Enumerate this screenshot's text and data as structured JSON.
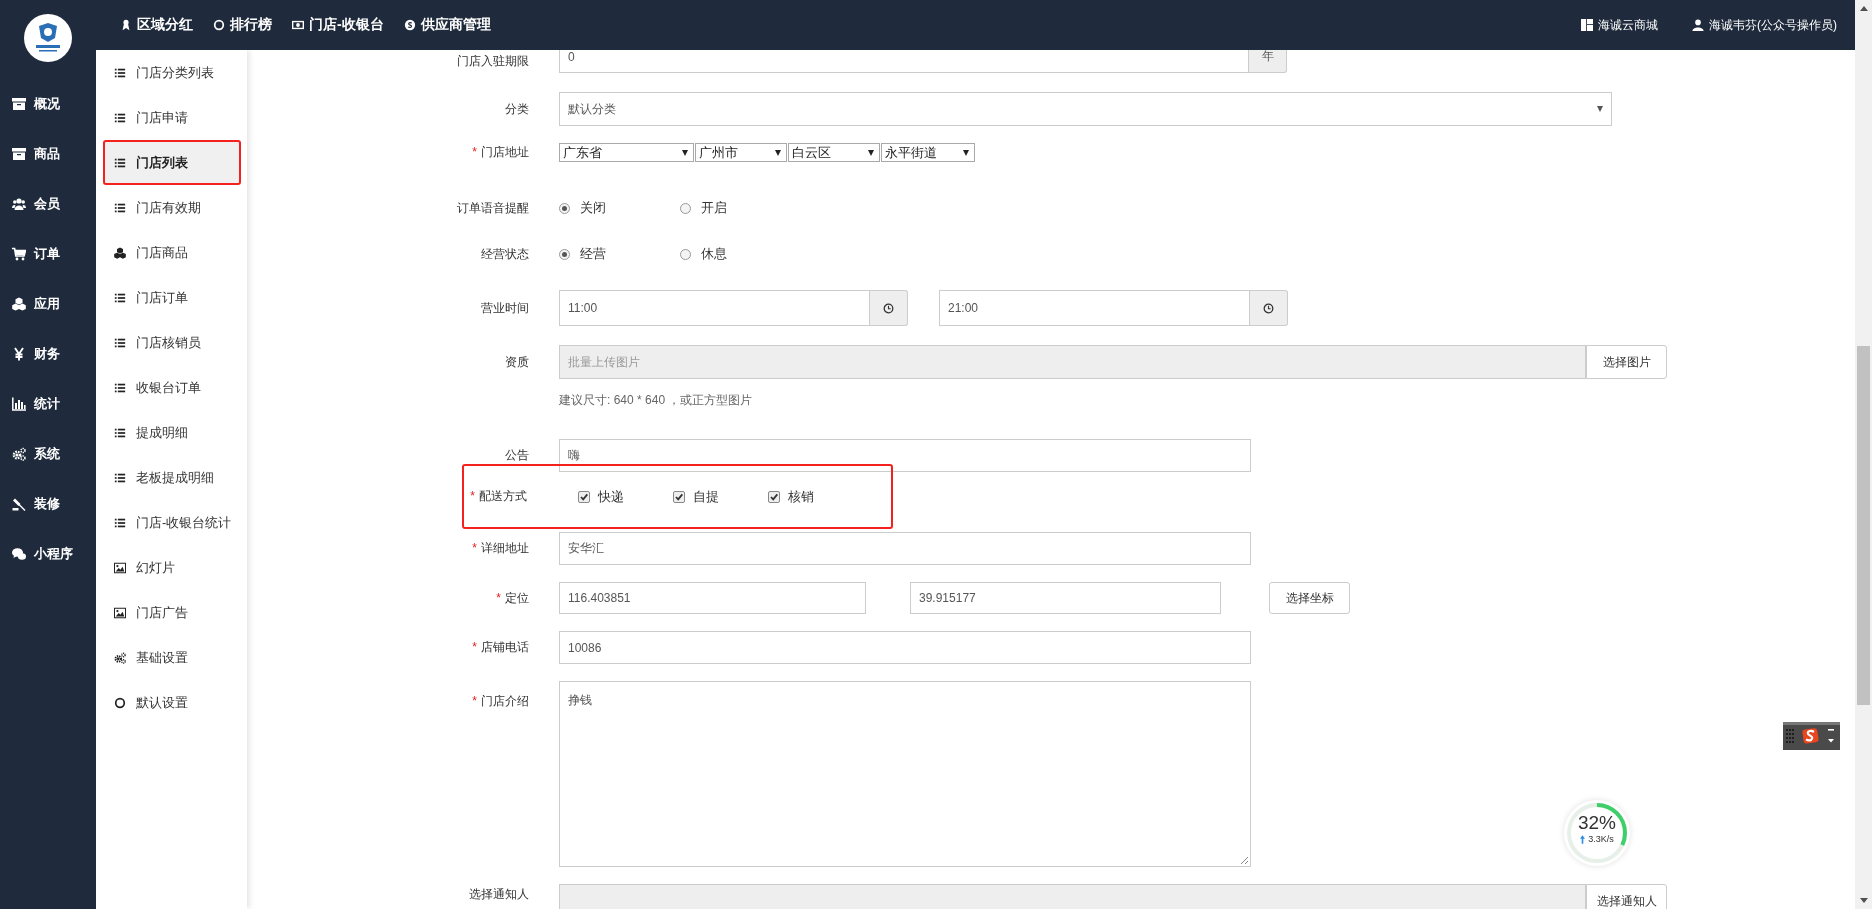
{
  "header": {
    "nav": [
      {
        "label": "区域分红"
      },
      {
        "label": "排行榜"
      },
      {
        "label": "门店-收银台"
      },
      {
        "label": "供应商管理"
      }
    ],
    "right": [
      {
        "label": "海诚云商城"
      },
      {
        "label": "海诚韦芬(公众号操作员)"
      }
    ]
  },
  "sidebar": {
    "items": [
      {
        "label": "概况"
      },
      {
        "label": "商品"
      },
      {
        "label": "会员"
      },
      {
        "label": "订单"
      },
      {
        "label": "应用"
      },
      {
        "label": "财务"
      },
      {
        "label": "统计"
      },
      {
        "label": "系统"
      },
      {
        "label": "装修"
      },
      {
        "label": "小程序"
      }
    ]
  },
  "subnav": {
    "items": [
      {
        "label": "门店分类列表",
        "selected": false,
        "outlined": false
      },
      {
        "label": "门店申请",
        "selected": false,
        "outlined": false
      },
      {
        "label": "门店列表",
        "selected": true,
        "outlined": true
      },
      {
        "label": "门店有效期",
        "selected": false,
        "outlined": false
      },
      {
        "label": "门店商品",
        "selected": false,
        "outlined": false
      },
      {
        "label": "门店订单",
        "selected": false,
        "outlined": false
      },
      {
        "label": "门店核销员",
        "selected": false,
        "outlined": false
      },
      {
        "label": "收银台订单",
        "selected": false,
        "outlined": false
      },
      {
        "label": "提成明细",
        "selected": false,
        "outlined": false
      },
      {
        "label": "老板提成明细",
        "selected": false,
        "outlined": false
      },
      {
        "label": "门店-收银台统计",
        "selected": false,
        "outlined": false
      },
      {
        "label": "幻灯片",
        "selected": false,
        "outlined": false
      },
      {
        "label": "门店广告",
        "selected": false,
        "outlined": false
      },
      {
        "label": "基础设置",
        "selected": false,
        "outlined": false
      },
      {
        "label": "默认设置",
        "selected": false,
        "outlined": false
      }
    ]
  },
  "form": {
    "rows": [
      {
        "kind": "addon",
        "label": "门店入驻期限",
        "value": "0",
        "addon": "年"
      },
      {
        "kind": "select",
        "label": "分类",
        "value": "默认分类"
      },
      {
        "kind": "region",
        "label": "门店地址",
        "mark": "*",
        "selects": [
          "广东省",
          "广州市",
          "白云区",
          "永平街道"
        ]
      },
      {
        "kind": "radio",
        "label": "订单语音提醒",
        "options": [
          {
            "label": "关闭",
            "selected": true
          },
          {
            "label": "开启",
            "selected": false
          }
        ]
      },
      {
        "kind": "radio",
        "label": "经营状态",
        "options": [
          {
            "label": "经营",
            "selected": true
          },
          {
            "label": "休息",
            "selected": false
          }
        ]
      },
      {
        "kind": "time",
        "label": "营业时间",
        "values": [
          "11:00",
          "21:00"
        ]
      },
      {
        "kind": "upload",
        "label": "资质",
        "placeholder": "批量上传图片",
        "button": "选择图片"
      },
      {
        "kind": "hint",
        "text": "建议尺寸: 640 * 640 ，或正方型图片"
      },
      {
        "kind": "text",
        "label": "公告",
        "value": "嗨"
      },
      {
        "kind": "checks",
        "label": "配送方式",
        "mark": "*",
        "outlined": true,
        "options": [
          {
            "label": "快递",
            "checked": true
          },
          {
            "label": "自提",
            "checked": true
          },
          {
            "label": "核销",
            "checked": true
          }
        ]
      },
      {
        "kind": "text",
        "label": "详细地址",
        "mark": "*",
        "value": "安华汇"
      },
      {
        "kind": "coords",
        "label": "定位",
        "mark": "*",
        "values": [
          "116.403851",
          "39.915177"
        ],
        "button": "选择坐标"
      },
      {
        "kind": "text",
        "label": "店铺电话",
        "mark": "*",
        "value": "10086"
      },
      {
        "kind": "textarea",
        "label": "门店介绍",
        "mark": "*",
        "value": "挣钱"
      },
      {
        "kind": "notify",
        "label": "选择通知人",
        "button": "选择通知人"
      }
    ]
  },
  "speed_meter": {
    "level": 0.32,
    "percent": "32%",
    "rate": "3.3K/s"
  }
}
